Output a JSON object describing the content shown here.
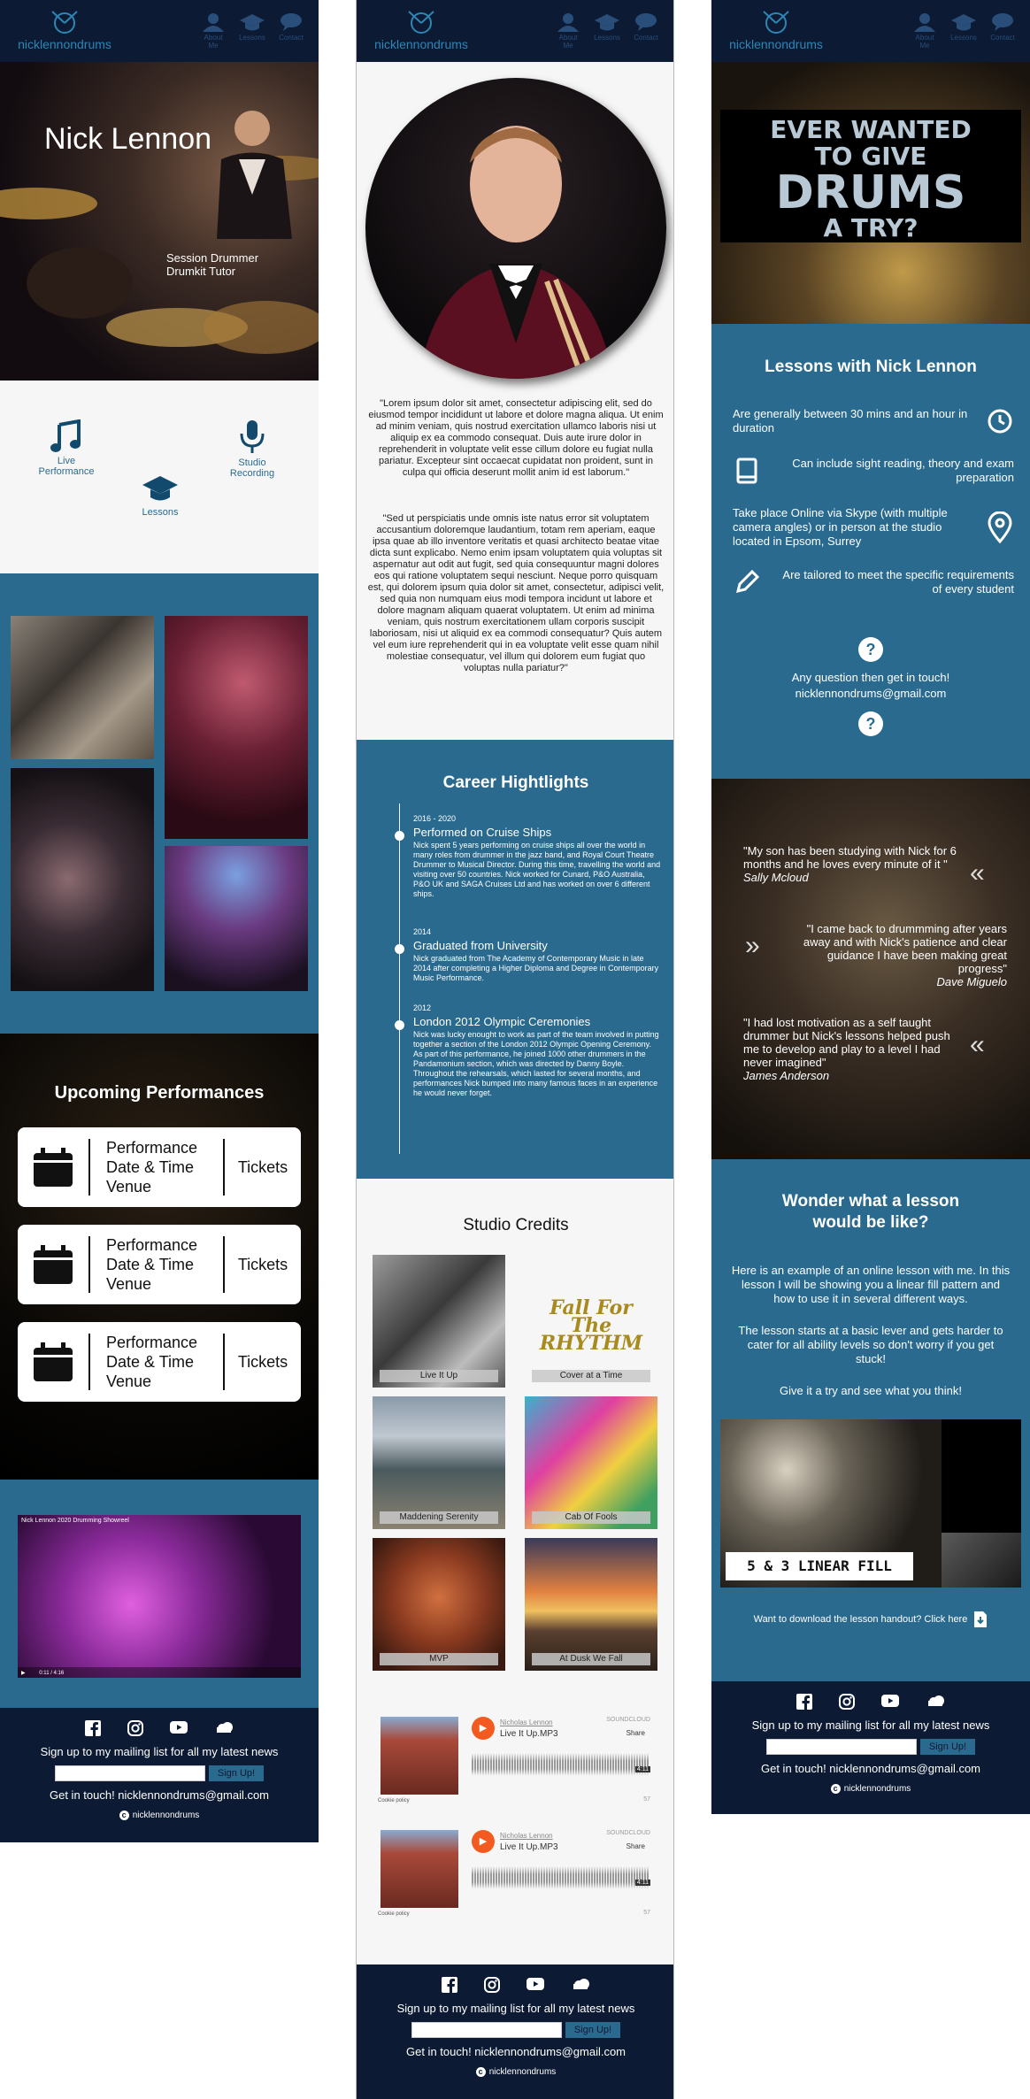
{
  "site": {
    "logo_text": "nicklennondrums",
    "nav": [
      "About Me",
      "Lessons",
      "Contact"
    ]
  },
  "home": {
    "hero_name": "Nick Lennon",
    "hero_sub1": "Session Drummer",
    "hero_sub2": "Drumkit Tutor",
    "services": {
      "live1": "Live",
      "live2": "Performance",
      "studio1": "Studio",
      "studio2": "Recording",
      "lessons": "Lessons"
    },
    "upcoming_title": "Upcoming Performances",
    "perf_line1": "Performance",
    "perf_line2": "Date & Time",
    "perf_line3": "Venue",
    "tickets": "Tickets",
    "video_title": "Nick Lennon 2020 Drumming Showreel",
    "video_time": "0:11 / 4:16"
  },
  "about": {
    "para1": "\"Lorem ipsum dolor sit amet, consectetur adipiscing elit, sed do eiusmod tempor incididunt ut labore et dolore magna aliqua. Ut enim ad minim veniam, quis nostrud exercitation ullamco laboris nisi ut aliquip ex ea commodo consequat. Duis aute irure dolor in reprehenderit in voluptate velit esse cillum dolore eu fugiat nulla pariatur. Excepteur sint occaecat cupidatat non proident, sunt in culpa qui officia deserunt mollit anim id est laborum.\"",
    "para2": "\"Sed ut perspiciatis unde omnis iste natus error sit voluptatem accusantium doloremque laudantium, totam rem aperiam, eaque ipsa quae ab illo inventore veritatis et quasi architecto beatae vitae dicta sunt explicabo. Nemo enim ipsam voluptatem quia voluptas sit aspernatur aut odit aut fugit, sed quia consequuntur magni dolores eos qui ratione voluptatem sequi nesciunt. Neque porro quisquam est, qui dolorem ipsum quia dolor sit amet, consectetur, adipisci velit, sed quia non numquam eius modi tempora incidunt ut labore et dolore magnam aliquam quaerat voluptatem. Ut enim ad minima veniam, quis nostrum exercitationem ullam corporis suscipit laboriosam, nisi ut aliquid ex ea commodi consequatur? Quis autem vel eum iure reprehenderit qui in ea voluptate velit esse quam nihil molestiae consequatur, vel illum qui dolorem eum fugiat quo voluptas nulla pariatur?\"",
    "career_title": "Career Hightlights",
    "career": [
      {
        "year": "2016 - 2020",
        "title": "Performed on Cruise Ships",
        "text": "Nick spent 5 years performing on  cruise ships all over the world in many roles from drummer in the jazz band, and Royal Court Theatre Drummer to Musical Director. During this time, travelling the world and visiting over 50 countries. Nick worked for Cunard, P&O Australia, P&O UK and SAGA Cruises Ltd and has worked on over 6 different ships."
      },
      {
        "year": "2014",
        "title": "Graduated from University",
        "text": "Nick graduated from The Academy of Contemporary Music in late 2014 after completing a Higher Diploma and Degree in Contemporary Music Performance."
      },
      {
        "year": "2012",
        "title": "London 2012 Olympic Ceremonies",
        "text": "Nick was lucky enought to work as part of the team involved in putting together a section of the London 2012 Olympic Opening Ceremony. As part of this performance, he joined 1000 other drummers in the Pandamonium section, which was directed by Danny Boyle.\nThroughout the rehearsals, which lasted for several months, and performances Nick bumped into many famous faces in an experience he would never forget."
      }
    ],
    "credits_title": "Studio Credits",
    "credits": [
      "Live It Up",
      "Cover at a Time",
      "Maddening Serenity",
      "Cab Of Fools",
      "MVP",
      "At Dusk We Fall"
    ],
    "rhythm_logo": "Fall For The RHYTHM",
    "soundcloud": [
      {
        "artist": "Nicholas Lennon",
        "track": "Live It Up.MP3",
        "brand": "SOUNDCLOUD",
        "share": "Share",
        "dur": "4:11",
        "plays": "57",
        "cookie": "Cookie policy"
      },
      {
        "artist": "Nicholas Lennon",
        "track": "Live It Up.MP3",
        "brand": "SOUNDCLOUD",
        "share": "Share",
        "dur": "4:11",
        "plays": "57",
        "cookie": "Cookie policy"
      }
    ]
  },
  "lessons": {
    "banner1": "EVER WANTED",
    "banner2": "TO GIVE",
    "banner3": "DRUMS",
    "banner4": "A TRY?",
    "title": "Lessons with Nick Lennon",
    "items": [
      "Are generally between 30 mins and an hour in duration",
      "Can include sight reading, theory and exam preparation",
      "Take place Online via Skype (with multiple camera angles) or in person at the studio located in Epsom, Surrey",
      "Are tailored to meet the specific requirements of every student"
    ],
    "question": "Any question then get in touch!",
    "email": "nicklennondrums@gmail.com",
    "testimonials": [
      {
        "quote": "\"My son has been studying with Nick for 6 months and he loves every minute of it \"",
        "name": "Sally Mcloud"
      },
      {
        "quote": "\"I came back to drummming after years away and with Nick's patience and clear guidance I have been making great progress\"",
        "name": "Dave Miguelo"
      },
      {
        "quote": "\"I had lost motivation as a self taught drummer but Nick's lessons helped push me to develop and play to a level I had never imagined\"",
        "name": "James Anderson"
      }
    ],
    "wonder_title1": "Wonder what a lesson",
    "wonder_title2": "would be like?",
    "wonder_p1": "Here is an example of an online lesson with me. In this lesson I will be showing you a linear fill pattern and how to use it in several different ways.",
    "wonder_p2": "The lesson starts at a basic lever and gets harder to cater for all ability levels so don't worry if you get stuck!",
    "wonder_p3": "Give it a try and see what you think!",
    "video_caption": "5 & 3 LINEAR FILL",
    "download": "Want to download the lesson handout? Click here"
  },
  "footer": {
    "mailing": "Sign up to my mailing list for all my latest news",
    "button": "Sign Up!",
    "contact": "Get in touch! nicklennondrums@gmail.com",
    "copyright": "nicklennondrums"
  },
  "colors": {
    "navy": "#0c1a33",
    "teal": "#2a6a8e",
    "light": "#f6f6f6",
    "soundcloud": "#f25a1f"
  }
}
